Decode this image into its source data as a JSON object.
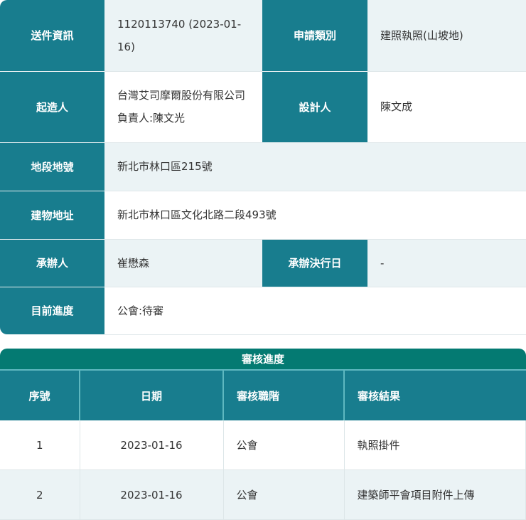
{
  "info": {
    "submission_label": "送件資訊",
    "submission_value": "1120113740 (2023-01-16)",
    "application_type_label": "申請類別",
    "application_type_value": "建照執照(山坡地)",
    "builder_label": "起造人",
    "builder_value": "台灣艾司摩爾股份有限公司負責人:陳文光",
    "designer_label": "設計人",
    "designer_value": "陳文成",
    "lot_label": "地段地號",
    "lot_value": "新北市林口區215號",
    "address_label": "建物地址",
    "address_value": "新北市林口區文化北路二段493號",
    "handler_label": "承辦人",
    "handler_value": "崔懋森",
    "decision_date_label": "承辦決行日",
    "decision_date_value": "-",
    "progress_label": "目前進度",
    "progress_value": "公會:待審"
  },
  "review": {
    "title": "審核進度",
    "columns": [
      "序號",
      "日期",
      "審核職階",
      "審核結果"
    ],
    "rows": [
      [
        "1",
        "2023-01-16",
        "公會",
        "執照掛件"
      ],
      [
        "2",
        "2023-01-16",
        "公會",
        "建築師平會項目附件上傳"
      ]
    ]
  }
}
